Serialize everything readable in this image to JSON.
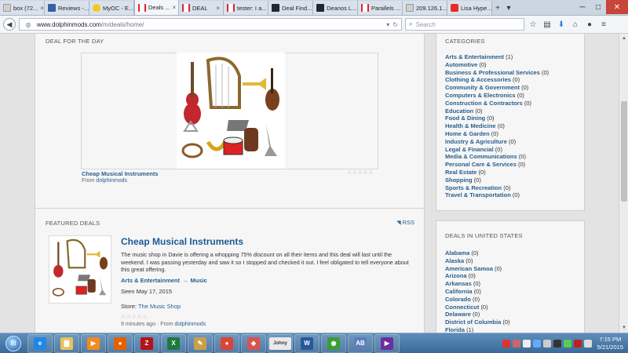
{
  "browser": {
    "tabs": [
      {
        "label": "box (72...",
        "icon": "inbox-icon",
        "fav": "grey",
        "active": false
      },
      {
        "label": "Reviews -...",
        "icon": "php-icon",
        "fav": "blue",
        "active": false
      },
      {
        "label": "MyOC - E...",
        "icon": "star-icon",
        "fav": "yellow",
        "active": false
      },
      {
        "label": "Deals ...",
        "icon": "deal-icon",
        "fav": "red",
        "active": true
      },
      {
        "label": "DEAL",
        "icon": "deal-icon",
        "fav": "red",
        "active": false
      },
      {
        "label": "tester: I a...",
        "icon": "deal-icon",
        "fav": "red",
        "active": false
      },
      {
        "label": "Deal Find...",
        "icon": "dealfind-icon",
        "fav": "dark",
        "active": false
      },
      {
        "label": "Deanos L...",
        "icon": "deanos-icon",
        "fav": "dark",
        "active": false
      },
      {
        "label": "Parallels ...",
        "icon": "deal-icon",
        "fav": "red",
        "active": false
      },
      {
        "label": "209.126.1...",
        "icon": "page-icon",
        "fav": "grey",
        "active": false
      },
      {
        "label": "Lisa Hype...",
        "icon": "youtube-icon",
        "fav": "yt",
        "active": false
      }
    ],
    "url_host": "www.dolphinmods.com",
    "url_path": "/m/deals/home/",
    "search_placeholder": "Search"
  },
  "deal_of_day": {
    "heading": "DEAL FOR THE DAY",
    "title": "Cheap Musical Instruments",
    "from_label": "From",
    "from_link": "dolphinmods",
    "stars": "☆☆☆☆☆"
  },
  "featured": {
    "heading": "FEATURED DEALS",
    "rss": "RSS",
    "title": "Cheap Musical Instruments",
    "description": "The music shop in Davie is offering a whopping 75% discount on all their items and this deal will last until the weekend. I was passing yesterday and saw it so I stopped and checked it out. I feel obligated to tell everyone about this great offering.",
    "category": "Arts & Entertainment",
    "arrow": "→",
    "subcategory": "Music",
    "seen": "Seen May 17, 2015",
    "store_label": "Store:",
    "store_link": "The Music Shop",
    "stars": "☆☆☆☆☆",
    "time_ago": "9 minutes ago · From",
    "time_from": "dolphinmods"
  },
  "categories": {
    "heading": "CATEGORIES",
    "items": [
      {
        "name": "Arts & Entertainment",
        "count": "(1)"
      },
      {
        "name": "Automotive",
        "count": "(0)"
      },
      {
        "name": "Business & Professional Services",
        "count": "(0)"
      },
      {
        "name": "Clothing & Accessories",
        "count": "(0)"
      },
      {
        "name": "Community & Government",
        "count": "(0)"
      },
      {
        "name": "Computers & Electronics",
        "count": "(0)"
      },
      {
        "name": "Construction & Contractors",
        "count": "(0)"
      },
      {
        "name": "Education",
        "count": "(0)"
      },
      {
        "name": "Food & Dining",
        "count": "(0)"
      },
      {
        "name": "Health & Medicine",
        "count": "(0)"
      },
      {
        "name": "Home & Garden",
        "count": "(0)"
      },
      {
        "name": "Industry & Agriculture",
        "count": "(0)"
      },
      {
        "name": "Legal & Financial",
        "count": "(0)"
      },
      {
        "name": "Media & Communications",
        "count": "(0)"
      },
      {
        "name": "Personal Care & Services",
        "count": "(0)"
      },
      {
        "name": "Real Estate",
        "count": "(0)"
      },
      {
        "name": "Shopping",
        "count": "(0)"
      },
      {
        "name": "Sports & Recreation",
        "count": "(0)"
      },
      {
        "name": "Travel & Transportation",
        "count": "(0)"
      }
    ]
  },
  "states": {
    "heading": "DEALS IN UNITED STATES",
    "items": [
      {
        "name": "Alabama",
        "count": "(0)"
      },
      {
        "name": "Alaska",
        "count": "(0)"
      },
      {
        "name": "American Samoa",
        "count": "(0)"
      },
      {
        "name": "Arizona",
        "count": "(0)"
      },
      {
        "name": "Arkansas",
        "count": "(0)"
      },
      {
        "name": "California",
        "count": "(0)"
      },
      {
        "name": "Colorado",
        "count": "(0)"
      },
      {
        "name": "Connecticut",
        "count": "(0)"
      },
      {
        "name": "Delaware",
        "count": "(0)"
      },
      {
        "name": "District of Columbia",
        "count": "(0)"
      },
      {
        "name": "Florida",
        "count": "(1)"
      }
    ]
  },
  "taskbar": {
    "apps": [
      {
        "icon": "internet-explorer-icon",
        "glyph": "e",
        "color": "#1e88e5"
      },
      {
        "icon": "file-explorer-icon",
        "glyph": "▇",
        "color": "#e8c25a"
      },
      {
        "icon": "media-player-icon",
        "glyph": "▶",
        "color": "#f28b20"
      },
      {
        "icon": "firefox-icon",
        "glyph": "●",
        "color": "#e66000"
      },
      {
        "icon": "filezilla-icon",
        "glyph": "Z",
        "color": "#b5121b"
      },
      {
        "icon": "excel-icon",
        "glyph": "X",
        "color": "#1d7a3e"
      },
      {
        "icon": "paint-icon",
        "glyph": "✎",
        "color": "#c9a04a"
      },
      {
        "icon": "chrome-icon",
        "glyph": "●",
        "color": "#db4437"
      },
      {
        "icon": "eraser-icon",
        "glyph": "◆",
        "color": "#d9534f"
      },
      {
        "icon": "johnny-icon",
        "glyph": "Johny",
        "color": "#eaeaea"
      },
      {
        "icon": "word-icon",
        "glyph": "W",
        "color": "#2b579a"
      },
      {
        "icon": "frog-icon",
        "glyph": "◉",
        "color": "#3a9d3a"
      },
      {
        "icon": "ab-icon",
        "glyph": "AB",
        "color": "#5b7fb8"
      },
      {
        "icon": "play-icon",
        "glyph": "▶",
        "color": "#6a2fa0"
      }
    ],
    "time": "7:15 PM",
    "date": "5/21/2015"
  },
  "colors": {
    "link": "#2a5d8f",
    "featured_title": "#1d5a94",
    "close_button": "#c7453a"
  }
}
